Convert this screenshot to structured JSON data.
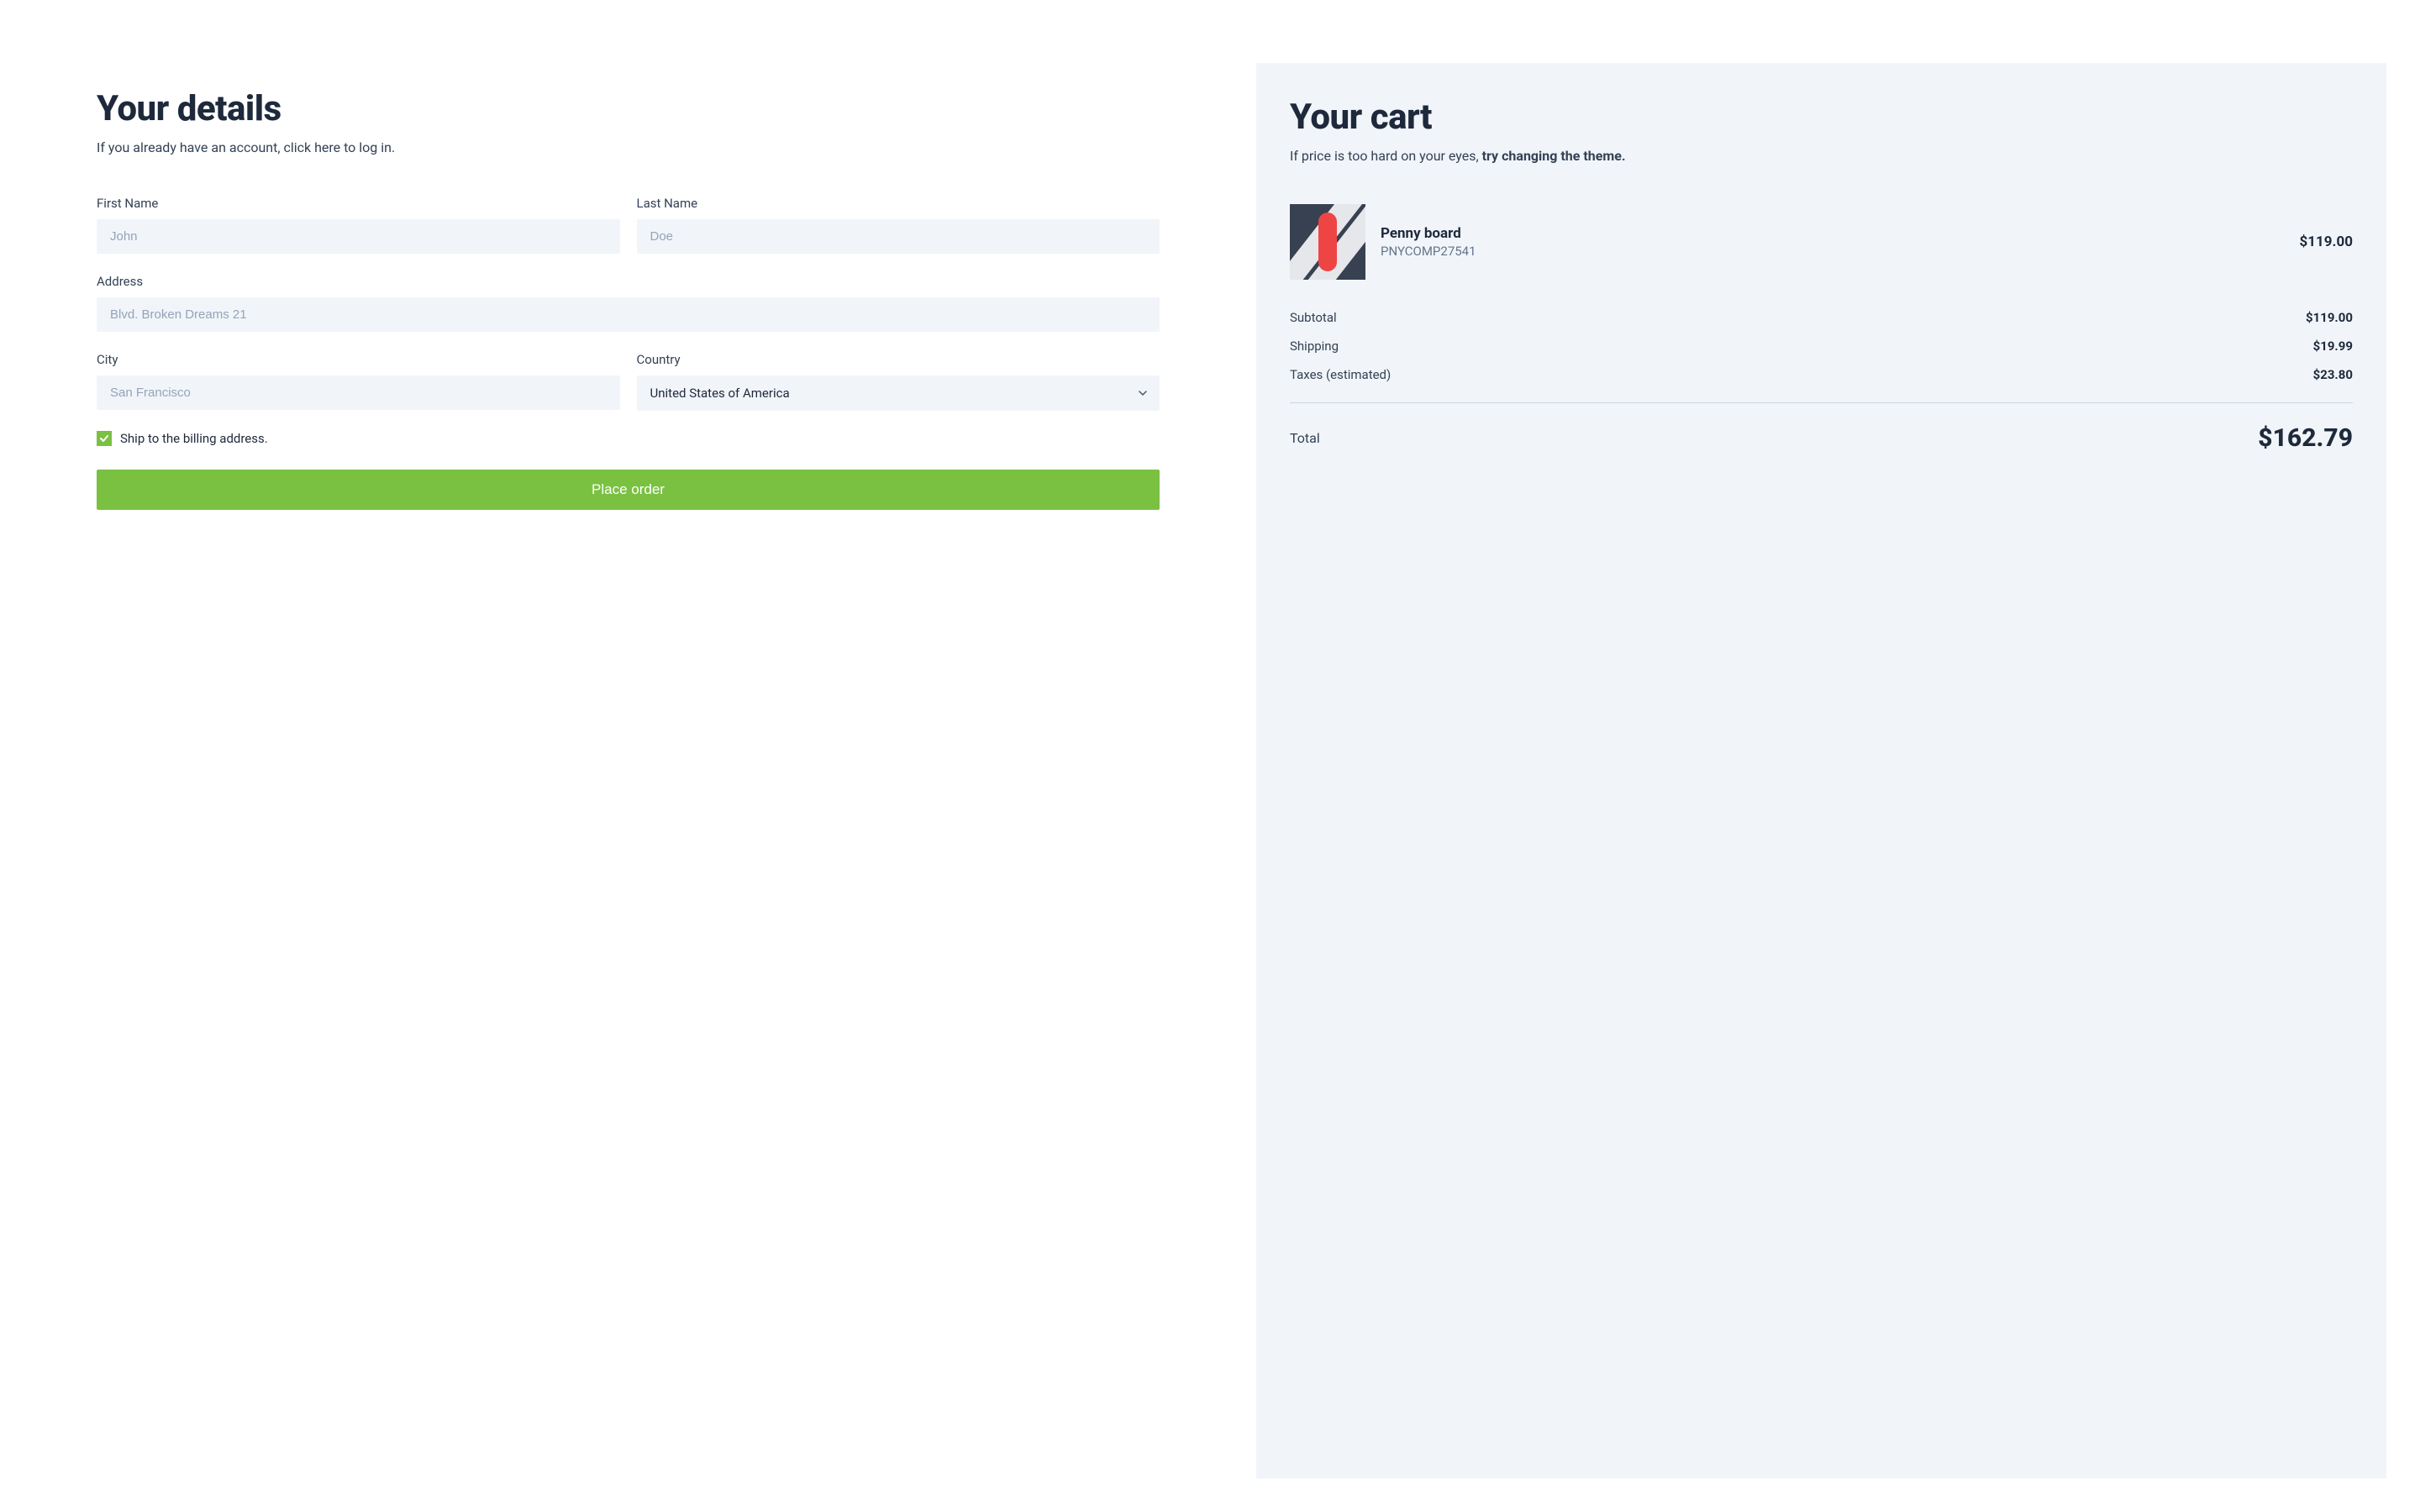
{
  "details": {
    "heading": "Your details",
    "subtitle": "If you already have an account, click here to log in.",
    "fields": {
      "first_name": {
        "label": "First Name",
        "placeholder": "John"
      },
      "last_name": {
        "label": "Last Name",
        "placeholder": "Doe"
      },
      "address": {
        "label": "Address",
        "placeholder": "Blvd. Broken Dreams 21"
      },
      "city": {
        "label": "City",
        "placeholder": "San Francisco"
      },
      "country": {
        "label": "Country",
        "selected": "United States of America"
      }
    },
    "ship_checkbox_label": "Ship to the billing address.",
    "place_order_label": "Place order"
  },
  "cart": {
    "heading": "Your cart",
    "subtitle_lead": "If price is too hard on your eyes, ",
    "subtitle_strong": "try changing the theme.",
    "item": {
      "name": "Penny board",
      "sku": "PNYCOMP27541",
      "price": "$119.00"
    },
    "summary": {
      "subtotal": {
        "label": "Subtotal",
        "value": "$119.00"
      },
      "shipping": {
        "label": "Shipping",
        "value": "$19.99"
      },
      "taxes": {
        "label": "Taxes (estimated)",
        "value": "$23.80"
      }
    },
    "total": {
      "label": "Total",
      "value": "$162.79"
    }
  }
}
